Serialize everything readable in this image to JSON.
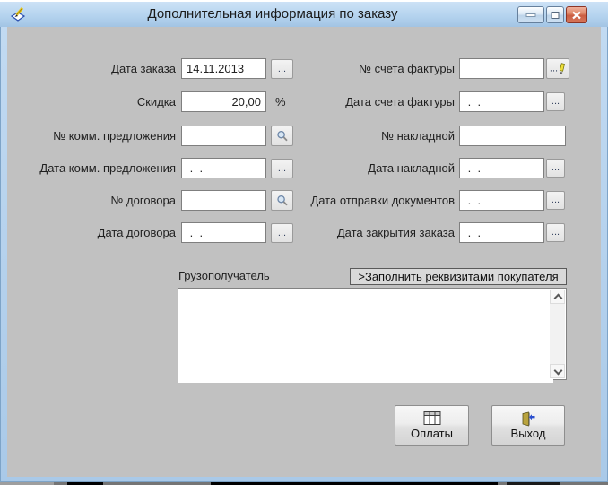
{
  "window": {
    "title": "Дополнительная информация по заказу",
    "icon": "writing-hand-icon",
    "controls": {
      "minimize": "minimize-icon",
      "restore": "restore-icon",
      "close": "close-icon"
    }
  },
  "fields": {
    "rows_left": [
      {
        "label": "Дата заказа",
        "value": "14.11.2013",
        "button": "..."
      },
      {
        "label": "Скидка",
        "value": "20,00",
        "suffix": "%"
      },
      {
        "label": "№ комм. предложения",
        "value": "",
        "button_icon": "magnifier-icon"
      },
      {
        "label": "Дата комм. предложения",
        "value": " .  .",
        "button": "..."
      },
      {
        "label": "№ договора",
        "value": "",
        "button_icon": "magnifier-icon"
      },
      {
        "label": "Дата договора",
        "value": " .  .",
        "button": "..."
      }
    ],
    "rows_right": [
      {
        "label": "№ счета фактуры",
        "value": "",
        "button": "...",
        "button_icon": "pencil-icon"
      },
      {
        "label": "Дата счета фактуры",
        "value": " .  .",
        "button": "..."
      },
      {
        "label": "№ накладной",
        "value": ""
      },
      {
        "label": "Дата накладной",
        "value": " .  .",
        "button": "..."
      },
      {
        "label": "Дата отправки документов",
        "value": " .  .",
        "button": "..."
      },
      {
        "label": "Дата закрытия заказа",
        "value": " .  .",
        "button": "..."
      }
    ]
  },
  "consignee": {
    "label": "Грузополучатель",
    "fill_button": ">Заполнить реквизитами покупателя",
    "text": ""
  },
  "actions": {
    "payments": {
      "label": "Оплаты",
      "icon": "table-icon"
    },
    "exit": {
      "label": "Выход",
      "icon": "exit-door-icon"
    }
  },
  "colors": {
    "titlebar_top": "#cde2f6",
    "titlebar_bottom": "#a2c4e4",
    "client_bg": "#c1c1c1",
    "close_red": "#cb5e42",
    "accent_blue": "#2b4fce"
  }
}
